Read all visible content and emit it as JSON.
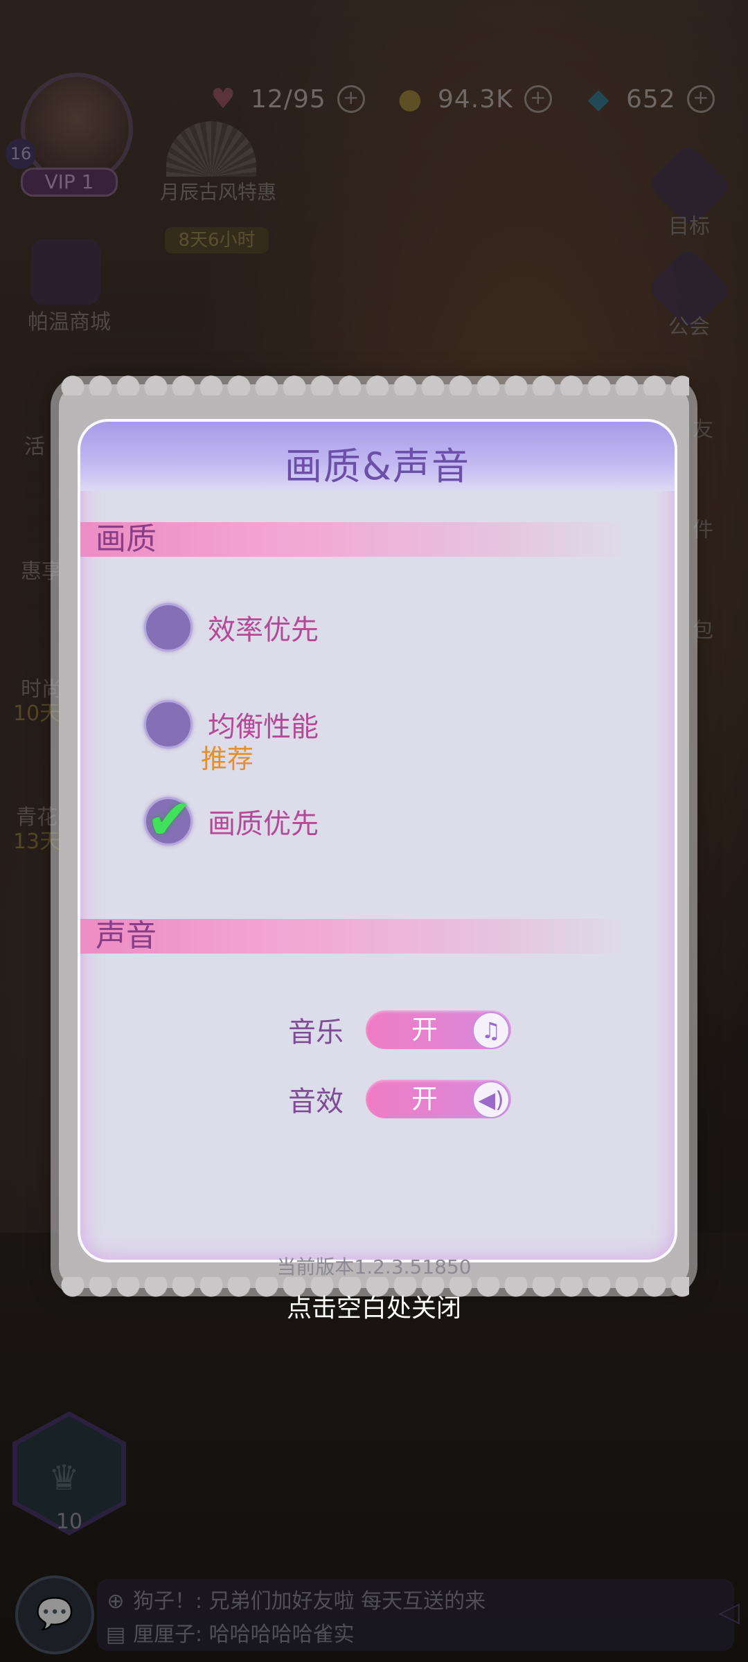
{
  "top_bar": {
    "hearts": "12/95",
    "coins": "94.3K",
    "gems": "652",
    "heart_icon": "heart-icon",
    "coin_icon": "coin-icon",
    "gem_icon": "diamond-icon"
  },
  "player": {
    "level": "16",
    "vip": "VIP 1"
  },
  "left_menu": {
    "event_title": "月辰古风特惠",
    "event_timer": "8天6小时",
    "shop": "帕温商城",
    "item_a": "活",
    "item_b": "惠享",
    "item_c": "时尚",
    "item_c_sub": "10天",
    "item_d": "青花",
    "item_d_sub": "13天"
  },
  "right_menu": {
    "goal": "目标",
    "guild": "公会",
    "friends": "友",
    "mail": "件",
    "bag": "包"
  },
  "dialog": {
    "title": "画质&声音",
    "quality_section": "画质",
    "options": [
      {
        "label": "效率优先",
        "selected": false
      },
      {
        "label": "均衡性能",
        "sub": "推荐",
        "selected": false
      },
      {
        "label": "画质优先",
        "selected": true
      }
    ],
    "sound_section": "声音",
    "music_label": "音乐",
    "music_state": "开",
    "sfx_label": "音效",
    "sfx_state": "开",
    "version": "当前版本1.2.3.51850",
    "close_hint": "点击空白处关闭"
  },
  "bottom": {
    "level": "10",
    "chat": [
      {
        "text": "狗子！: 兄弟们加好友啦 每天互送的来"
      },
      {
        "text": "厘厘子: 哈哈哈哈哈雀实"
      }
    ]
  },
  "colors": {
    "accent_pink": "#ef7cc4",
    "accent_purple": "#8570b5",
    "title_purple": "#6c4fa8",
    "check_green": "#3fe25a",
    "recommend_orange": "#e2902e"
  }
}
